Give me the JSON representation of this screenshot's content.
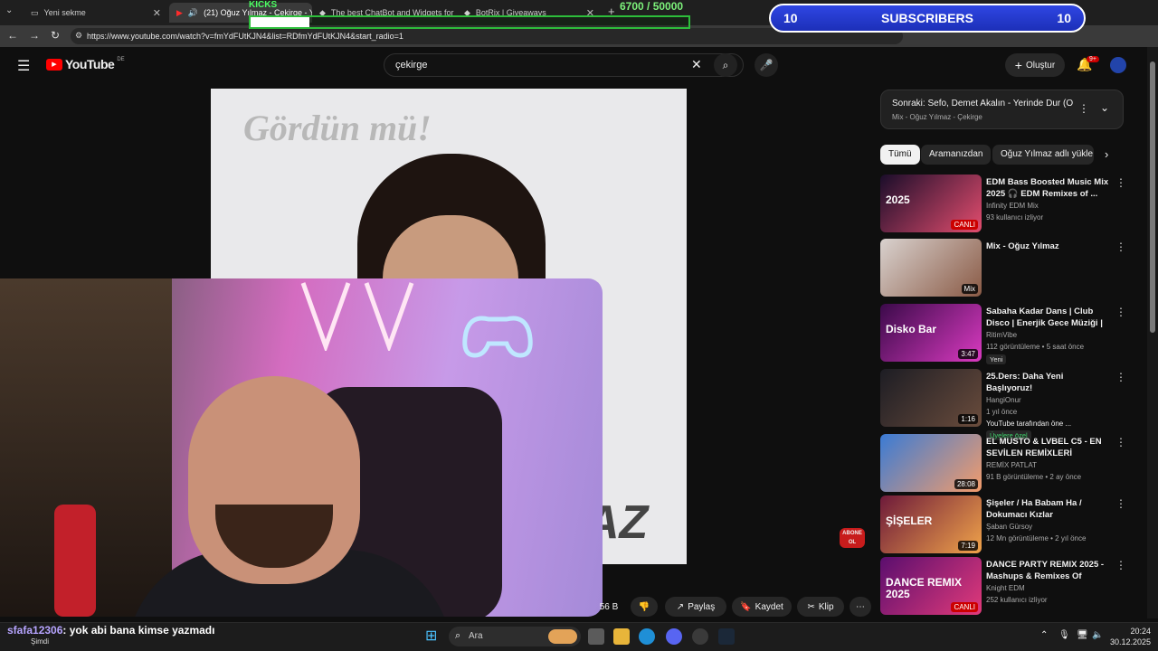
{
  "browser": {
    "tabs": [
      {
        "label": "Yeni sekme"
      },
      {
        "label": "(21) Oğuz Yılmaz - Çekirge - Y"
      },
      {
        "label": "The best ChatBot and Widgets for"
      },
      {
        "label": "BotRix | Giveaways"
      }
    ],
    "url": "https://www.youtube.com/watch?v=fmYdFUtKJN4&list=RDfmYdFUtKJN4&start_radio=1"
  },
  "overlay": {
    "goal_label": "KICKS",
    "goal_count": "6700 / 50000",
    "goal_progress": 0.134,
    "subs_left": "10",
    "subs_label": "SUBSCRIBERS",
    "subs_right": "10"
  },
  "youtube": {
    "logo": "YouTube",
    "region": "DE",
    "search_value": "çekirge",
    "create_label": "Oluştur",
    "notif_count": "9+",
    "video": {
      "caption": "Gördün mü!",
      "name_fragment": "AZ"
    },
    "actions": {
      "dislike_count": "56 B",
      "share": "Paylaş",
      "save": "Kaydet",
      "clip": "Klip"
    },
    "abone": "ABONE OL",
    "upnext": {
      "title": "Sonraki: Sefo, Demet Akalın - Yerinde Dur (Off...",
      "subtitle": "Mix - Oğuz Yılmaz - Çekirge"
    },
    "chips": [
      "Tümü",
      "Aramanızdan",
      "Oğuz Yılmaz adlı yükle"
    ],
    "recs": [
      {
        "title": "EDM Bass Boosted Music Mix 2025 🎧 EDM Remixes of ...",
        "channel": "Infinity EDM Mix",
        "meta": "93 kullanıcı izliyor",
        "badge": "",
        "dur": "CANLI",
        "live": true,
        "thumb_text": "2025",
        "c1": "#1a0d2a",
        "c2": "#e34d6e"
      },
      {
        "title": "Mix - Oğuz Yılmaz",
        "channel": "",
        "meta": "",
        "badge": "",
        "dur": "Mix",
        "live": false,
        "thumb_text": "",
        "c1": "#d9d2cf",
        "c2": "#8a5a45"
      },
      {
        "title": "Sabaha Kadar Dans | Club Disco | Enerjik Gece Müziği | Dance ...",
        "channel": "RitimVibe",
        "meta": "112 görüntüleme • 5 saat önce",
        "badge": "Yeni",
        "dur": "3:47",
        "live": false,
        "thumb_text": "Disko Bar",
        "c1": "#3b0a4a",
        "c2": "#d93ac0"
      },
      {
        "title": "25.Ders: Daha Yeni Başlıyoruz!",
        "channel": "HangiOnur",
        "meta": "1 yıl önce",
        "extra": "YouTube tarafından öne ...",
        "badge": "Üyelere özel",
        "dur": "1:16",
        "live": false,
        "thumb_text": "",
        "c1": "#1d1d24",
        "c2": "#6a4c3c"
      },
      {
        "title": "EL MUSTO & LVBEL C5 - EN SEVİLEN REMİXLERİ",
        "channel": "REMİX PATLAT",
        "meta": "91 B görüntüleme • 2 ay önce",
        "badge": "",
        "dur": "28:08",
        "live": false,
        "thumb_text": "",
        "c1": "#3a7bd5",
        "c2": "#f39c6b"
      },
      {
        "title": "Şişeler / Ha Babam Ha / Dokumacı Kızlar",
        "channel": "Şaban Gürsoy",
        "meta": "12 Mn görüntüleme • 2 yıl önce",
        "badge": "",
        "dur": "7:19",
        "live": false,
        "thumb_text": "ŞİŞELER",
        "c1": "#6d1a3a",
        "c2": "#f0a34a"
      },
      {
        "title": "DANCE PARTY REMIX 2025 - Mashups & Remixes Of Popul...",
        "channel": "Knight EDM",
        "meta": "252 kullanıcı izliyor",
        "badge": "",
        "dur": "CANLI",
        "live": true,
        "thumb_text": "DANCE REMIX 2025",
        "c1": "#5a0e6e",
        "c2": "#e23a7a"
      }
    ]
  },
  "chat": {
    "user": "sfafa12306",
    "message": ": yok abi bana kimse yazmadı",
    "time": "Şimdi"
  },
  "taskbar": {
    "search_placeholder": "Ara",
    "time": "20:24",
    "date": "30.12.2025"
  }
}
